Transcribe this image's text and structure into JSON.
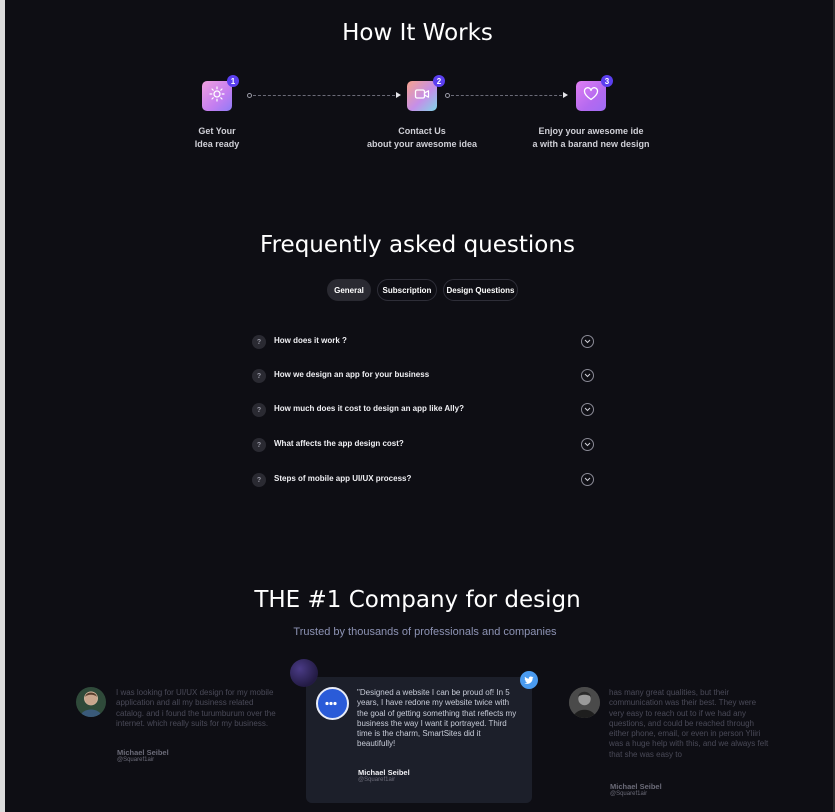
{
  "how_it_works": {
    "title": "How It Works",
    "steps": [
      {
        "number": "1",
        "icon": "sun-icon",
        "line1": "Get Your",
        "line2": "Idea ready"
      },
      {
        "number": "2",
        "icon": "video-camera-icon",
        "line1": "Contact Us",
        "line2": "about your awesome idea"
      },
      {
        "number": "3",
        "icon": "heart-icon",
        "line1": "Enjoy your awesome ide",
        "line2": "a with a barand new design"
      }
    ]
  },
  "faq": {
    "title": "Frequently asked questions",
    "tabs": [
      {
        "label": "General",
        "active": true
      },
      {
        "label": "Subscription",
        "active": false
      },
      {
        "label": "Design Questions",
        "active": false
      }
    ],
    "q_mark": "?",
    "items": [
      {
        "question": "How does it work ?"
      },
      {
        "question": "How we design an app for your business"
      },
      {
        "question": "How much does it cost to design an app like Ally?"
      },
      {
        "question": "What affects the app design cost?"
      },
      {
        "question": "Steps of mobile app UI/UX process?"
      }
    ]
  },
  "company": {
    "title": "THE #1 Company for design",
    "subtitle": "Trusted by thousands of professionals and companies"
  },
  "testimonials": {
    "left": {
      "text": "I was looking for UI/UX design for my mobile application and all my business related catalog. and i found the turumburum over the internet. which really suits for my business.",
      "name": "Michael Seibel",
      "handle": "@Squaref1air"
    },
    "center": {
      "text": "\"Designed a website I can be proud of! In 5 years, I have redone my website twice with the goal of getting something that reflects my business the way I want it portrayed. Third time is the charm, SmartSites did it beautifully!",
      "name": "Michael Seibel",
      "handle": "@Squaref1air",
      "badge_icon": "twitter-icon"
    },
    "right": {
      "text": "has many great qualities, but their communication was their best. They were very easy to reach out to if we had any questions, and could be reached through either phone, email, or even in person Yliiri was a huge help with this, and we always felt that she was easy to",
      "name": "Michael Seibel",
      "handle": "@Squaref1air"
    }
  },
  "colors": {
    "background": "#0e0e14",
    "accent": "#5b3ff0",
    "card": "#1c1f2a",
    "twitter": "#4a9bf0"
  }
}
